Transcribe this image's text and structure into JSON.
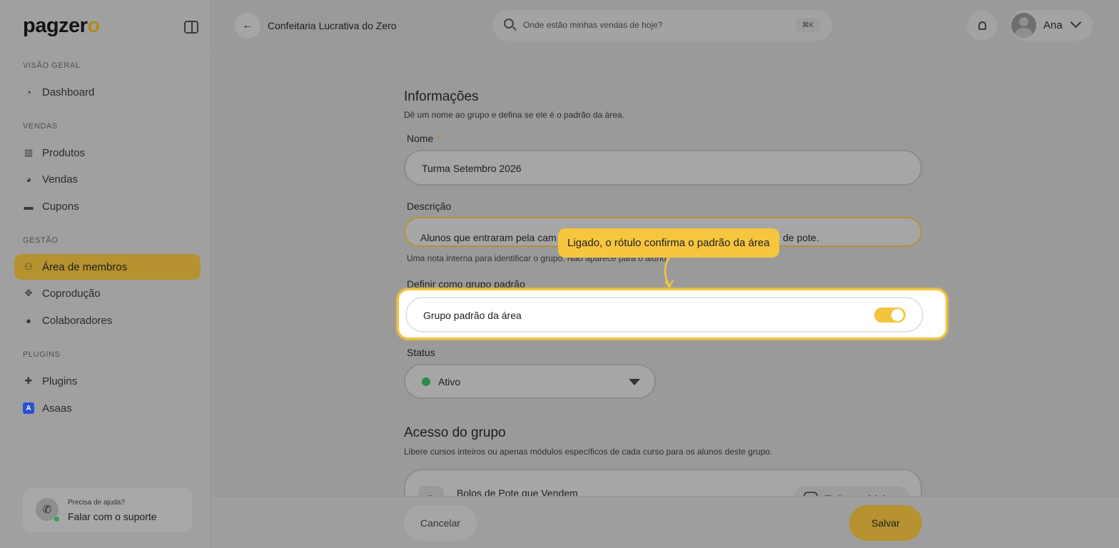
{
  "app": {
    "logo_text": "pagzer",
    "logo_o": "o"
  },
  "sidebar": {
    "sections": [
      {
        "label": "VISÃO GERAL"
      },
      {
        "label": "VENDAS"
      },
      {
        "label": "GESTÃO"
      },
      {
        "label": "PLUGINS"
      }
    ],
    "items": [
      {
        "label": "Dashboard",
        "icon": "dashboard-icon"
      },
      {
        "label": "Produtos",
        "icon": "products-icon"
      },
      {
        "label": "Vendas",
        "icon": "sales-icon"
      },
      {
        "label": "Cupons",
        "icon": "coupon-icon"
      },
      {
        "label": "Área de membros",
        "icon": "members-icon",
        "active": true
      },
      {
        "label": "Coprodução",
        "icon": "handshake-icon"
      },
      {
        "label": "Colaboradores",
        "icon": "user-icon"
      },
      {
        "label": "Plugins",
        "icon": "puzzle-icon"
      },
      {
        "label": "Asaas",
        "icon": "asaas-icon",
        "icon_letter": "A"
      }
    ],
    "help": {
      "small": "Precisa de ajuda?",
      "big": "Falar com o suporte"
    }
  },
  "header": {
    "title": "Confeitaria Lucrativa do Zero",
    "search_placeholder": "Onde estão minhas vendas de hoje?",
    "search_shortcut": "⌘K",
    "user_name": "Ana"
  },
  "form": {
    "info_title": "Informações",
    "info_subtitle": "Dê um nome ao grupo e defina se ele é o padrão da área.",
    "name_label": "Nome",
    "name_required": "*",
    "name_value": "Turma Setembro 2026",
    "desc_label": "Descrição",
    "desc_value_start": "Alunos que entraram pela cam",
    "desc_value_end": "de pote.",
    "desc_hint": "Uma nota interna para identificar o grupo. Não aparece para o aluno.",
    "default_label": "Definir como grupo padrão",
    "toggle_label": "Grupo padrão da área",
    "toggle_on": true,
    "status_label": "Status",
    "status_value": "Ativo",
    "status_color": "#2f8a46",
    "access_title": "Acesso do grupo",
    "access_subtitle": "Libere cursos inteiros ou apenas módulos específicos de cada curso para os alunos deste grupo.",
    "course_letter": "B",
    "course_name": "Bolos de Pote que Vendem",
    "course_select": "Todo o módulo"
  },
  "footer": {
    "cancel_label": "Cancelar",
    "save_label": "Salvar"
  },
  "tooltip": {
    "text": "Ligado, o rótulo confirma o padrão da área"
  },
  "colors": {
    "accent": "#f2c43c",
    "brand_dim": "#b69230"
  }
}
